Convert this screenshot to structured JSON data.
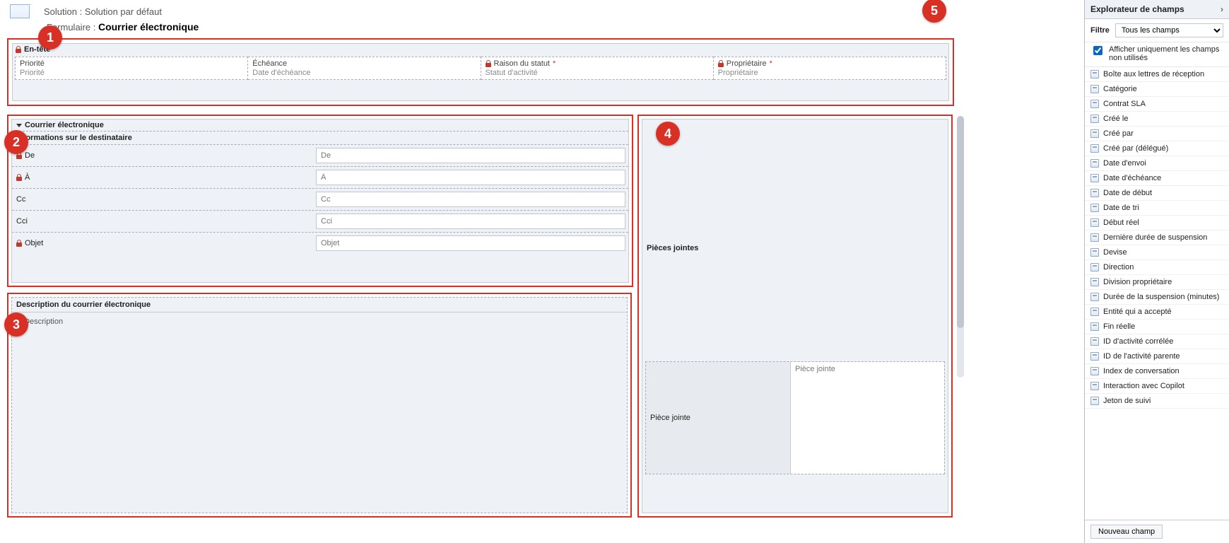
{
  "solution_line_prefix": "Solution : ",
  "solution_name": "Solution par défaut",
  "form_line_prefix": "Formulaire : ",
  "form_name": "Courrier électronique",
  "badges": {
    "b1": "1",
    "b2": "2",
    "b3": "3",
    "b4": "4",
    "b5": "5"
  },
  "header_section": {
    "title": "En-tête",
    "cells": [
      {
        "label": "Priorité",
        "value": "Priorité",
        "locked": false,
        "required": false
      },
      {
        "label": "Échéance",
        "value": "Date d'échéance",
        "locked": false,
        "required": false
      },
      {
        "label": "Raison du statut",
        "value": "Statut d'activité",
        "locked": true,
        "required": true
      },
      {
        "label": "Propriétaire",
        "value": "Propriétaire",
        "locked": true,
        "required": true
      }
    ]
  },
  "tab2": {
    "tab_title": "Courrier électronique",
    "section_title": "Informations sur le destinataire",
    "rows": [
      {
        "label": "De",
        "placeholder": "De",
        "locked": true
      },
      {
        "label": "À",
        "placeholder": "À",
        "locked": true
      },
      {
        "label": "Cc",
        "placeholder": "Cc",
        "locked": false
      },
      {
        "label": "Cci",
        "placeholder": "Cci",
        "locked": false
      },
      {
        "label": "Objet",
        "placeholder": "Objet",
        "locked": true
      }
    ]
  },
  "desc_section": {
    "title": "Description du courrier électronique",
    "label": "Description"
  },
  "attachments": {
    "title": "Pièces jointes",
    "field_label": "Pièce jointe",
    "placeholder": "Pièce jointe"
  },
  "explorer": {
    "title": "Explorateur de champs",
    "filter_label": "Filtre",
    "filter_value": "Tous les champs",
    "checkbox_label": "Afficher uniquement les champs non utilisés",
    "checkbox_checked": true,
    "fields": [
      "Boîte aux lettres de réception",
      "Catégorie",
      "Contrat SLA",
      "Créé le",
      "Créé par",
      "Créé par (délégué)",
      "Date d'envoi",
      "Date d'échéance",
      "Date de début",
      "Date de tri",
      "Début réel",
      "Dernière durée de suspension",
      "Devise",
      "Direction",
      "Division propriétaire",
      "Durée de la suspension (minutes)",
      "Entité qui a accepté",
      "Fin réelle",
      "ID d'activité corrélée",
      "ID de l'activité parente",
      "Index de conversation",
      "Interaction avec Copilot",
      "Jeton de suivi"
    ],
    "new_field_button": "Nouveau champ"
  }
}
